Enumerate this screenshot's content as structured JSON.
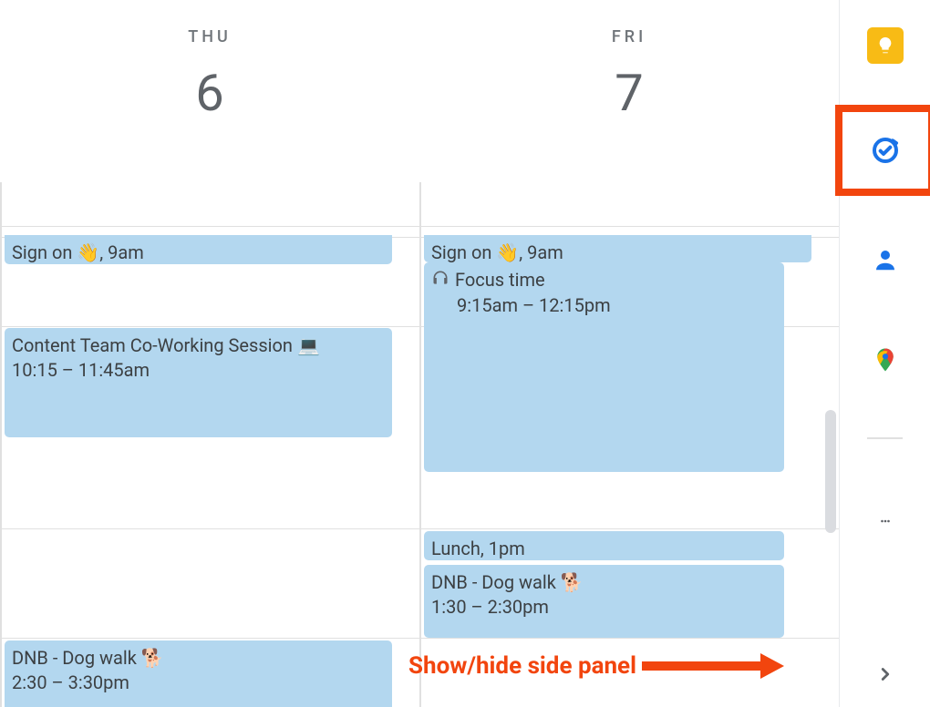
{
  "days": {
    "thu": {
      "dow": "THU",
      "num": "6"
    },
    "fri": {
      "dow": "FRI",
      "num": "7"
    }
  },
  "events": {
    "thu_signon": {
      "line": "Sign on 👋, 9am"
    },
    "thu_cowork": {
      "title": "Content Team Co-Working Session 💻",
      "time": "10:15 – 11:45am"
    },
    "thu_dog": {
      "title": "DNB - Dog walk 🐕",
      "time": "2:30 – 3:30pm"
    },
    "fri_signon": {
      "line": "Sign on 👋, 9am"
    },
    "fri_focus": {
      "title": "Focus time",
      "time": "9:15am – 12:15pm"
    },
    "fri_lunch": {
      "line": "Lunch, 1pm"
    },
    "fri_dnb": {
      "title": "DNB - Dog walk 🐕",
      "time": "1:30 – 2:30pm"
    }
  },
  "side": {
    "keep": "Keep",
    "tasks": "Tasks",
    "contacts": "Contacts",
    "maps": "Maps",
    "addons": "Get Add-ons",
    "toggle": "Show side panel"
  },
  "annotation": "Show/hide side panel"
}
